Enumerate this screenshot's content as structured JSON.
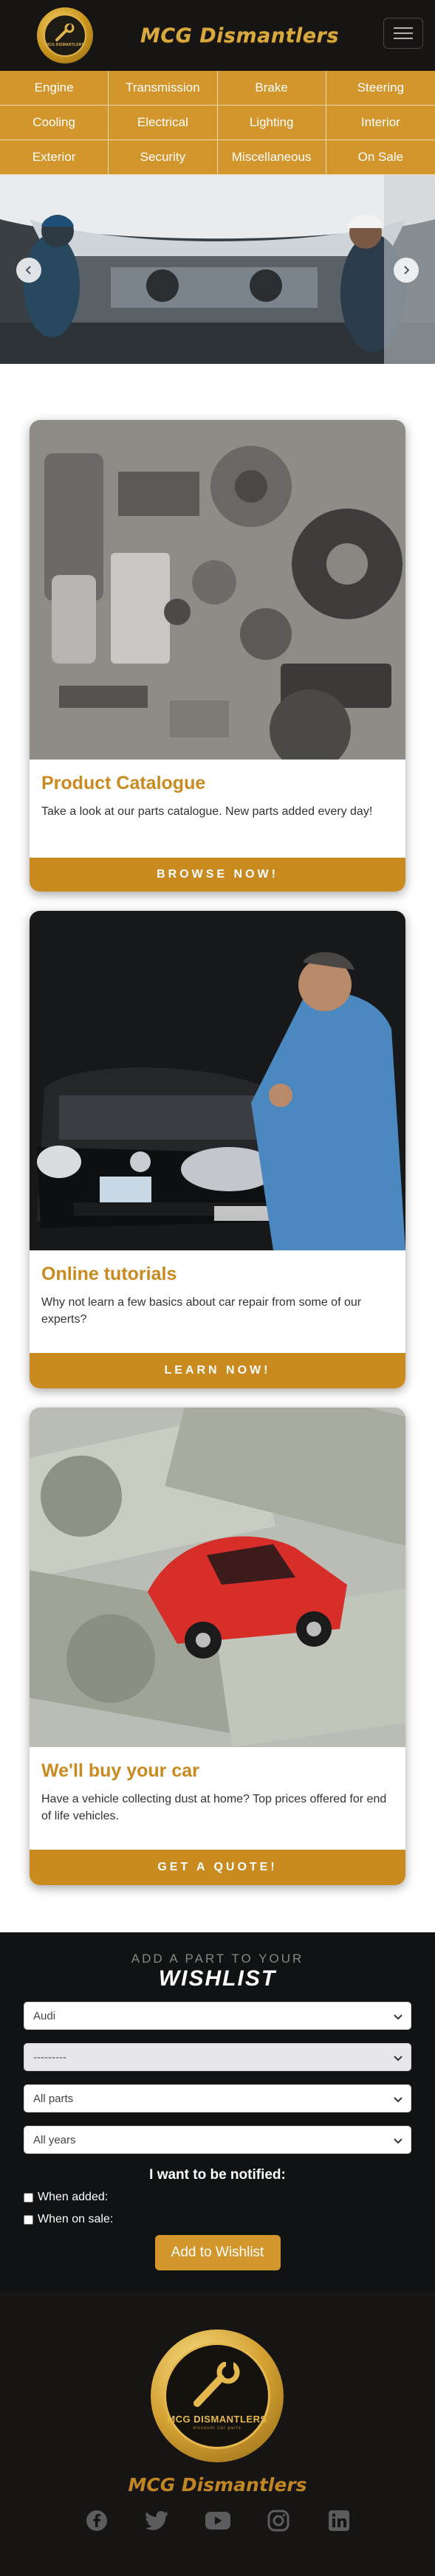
{
  "header": {
    "badge_text": "MCG DISMANTLERS",
    "brand": "MCG Dismantlers",
    "menu_icon": "hamburger-icon"
  },
  "categories": [
    "Engine",
    "Transmission",
    "Brake",
    "Steering",
    "Cooling",
    "Electrical",
    "Lighting",
    "Interior",
    "Exterior",
    "Security",
    "Miscellaneous",
    "On Sale"
  ],
  "hero": {
    "prev_icon": "chevron-left-icon",
    "next_icon": "chevron-right-icon"
  },
  "cards": [
    {
      "title": "Product Catalogue",
      "text": "Take a look at our parts catalogue. New parts added every day!",
      "cta": "BROWSE NOW!"
    },
    {
      "title": "Online tutorials",
      "text": "Why not learn a few basics about car repair from some of our experts?",
      "cta": "LEARN NOW!"
    },
    {
      "title": "We'll buy your car",
      "text": "Have a vehicle collecting dust at home? Top prices offered for end of life vehicles.",
      "cta": "GET A QUOTE!"
    }
  ],
  "wishlist": {
    "subtitle": "ADD A PART TO YOUR",
    "title": "WISHLIST",
    "make": "Audi",
    "model": "---------",
    "part": "All parts",
    "year": "All years",
    "notify_label": "I want to be notified:",
    "when_added": "When added:",
    "when_on_sale": "When on sale:",
    "button": "Add to Wishlist"
  },
  "footer": {
    "badge_text": "MCG DISMANTLERS",
    "badge_sub": "discount car parts",
    "brand": "MCG Dismantlers",
    "socials": [
      "facebook-icon",
      "twitter-icon",
      "youtube-icon",
      "instagram-icon",
      "linkedin-icon"
    ]
  },
  "colors": {
    "gold": "#d3962c",
    "dark": "#171414",
    "accent_text": "#c98a1f"
  }
}
